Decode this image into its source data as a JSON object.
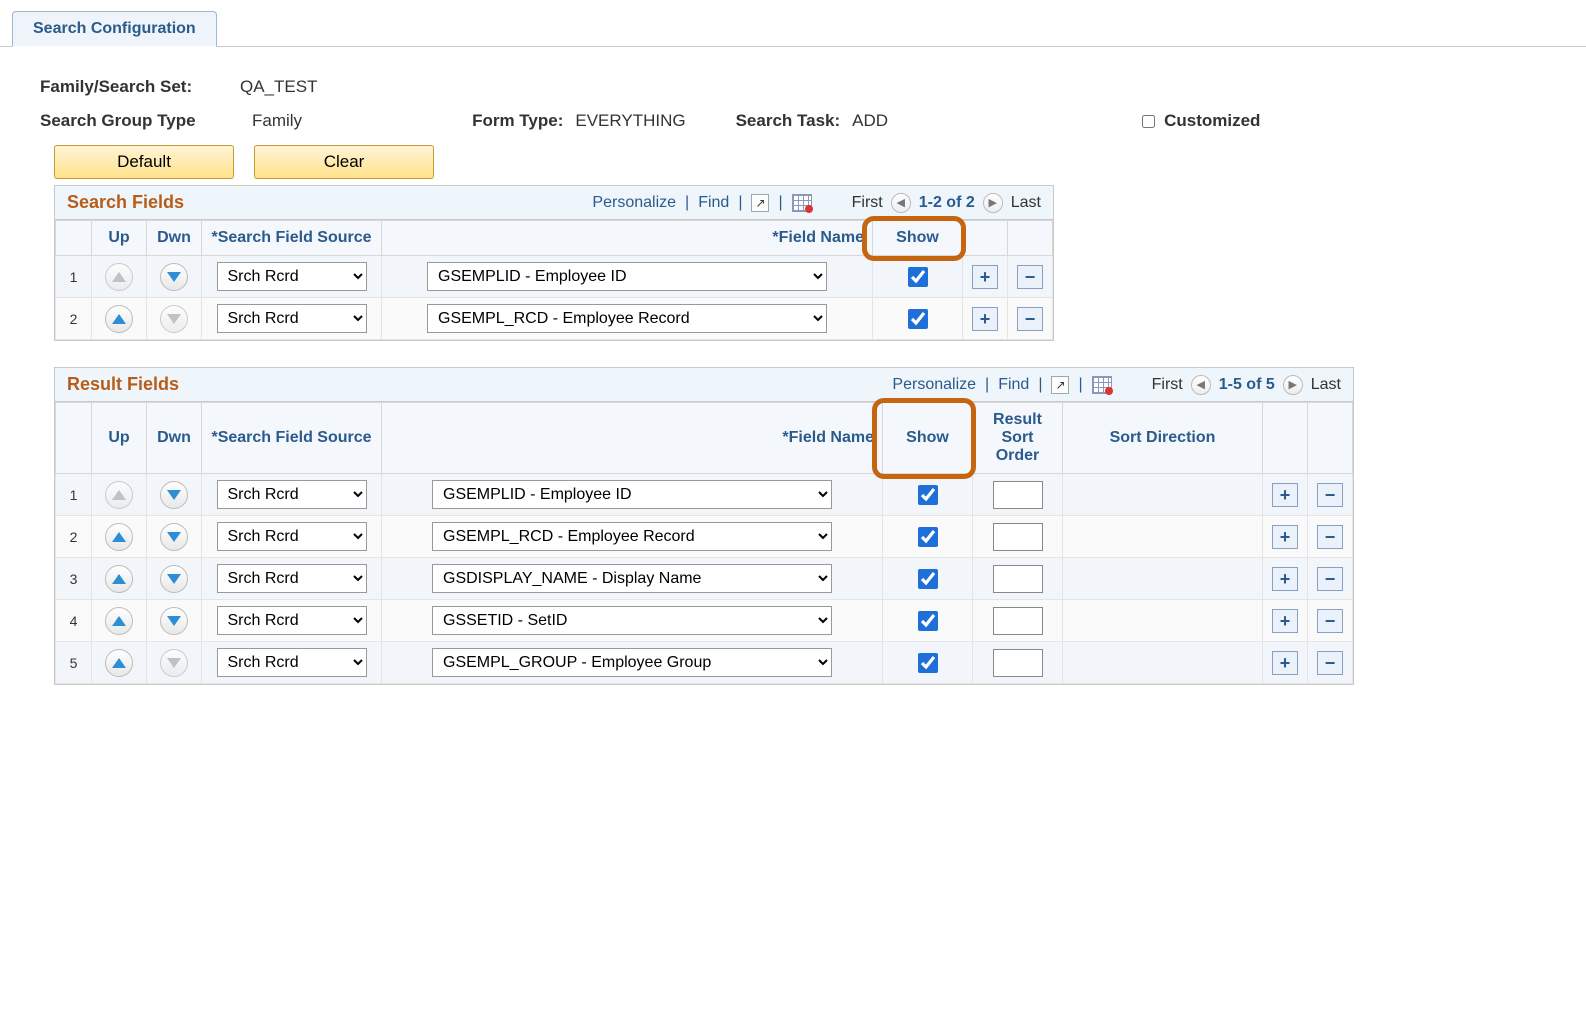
{
  "tab": {
    "label": "Search Configuration"
  },
  "header": {
    "family_label": "Family/Search Set:",
    "family_value": "QA_TEST",
    "group_type_label": "Search Group Type",
    "group_type_value": "Family",
    "form_type_label": "Form Type:",
    "form_type_value": "EVERYTHING",
    "search_task_label": "Search Task:",
    "search_task_value": "ADD",
    "customized_label": "Customized"
  },
  "buttons": {
    "default": "Default",
    "clear": "Clear"
  },
  "grid_common": {
    "personalize": "Personalize",
    "find": "Find",
    "first": "First",
    "last": "Last"
  },
  "search_grid": {
    "title": "Search Fields",
    "nav_info": "1-2 of 2",
    "cols": {
      "up": "Up",
      "dwn": "Dwn",
      "source": "*Search Field Source",
      "field": "*Field Name",
      "show": "Show"
    },
    "rows": [
      {
        "n": "1",
        "up_enabled": false,
        "dwn_enabled": true,
        "source": "Srch Rcrd",
        "field": "GSEMPLID - Employee ID",
        "show": true
      },
      {
        "n": "2",
        "up_enabled": true,
        "dwn_enabled": false,
        "source": "Srch Rcrd",
        "field": "GSEMPL_RCD - Employee Record",
        "show": true
      }
    ]
  },
  "result_grid": {
    "title": "Result Fields",
    "nav_info": "1-5 of 5",
    "cols": {
      "up": "Up",
      "dwn": "Dwn",
      "source": "*Search Field Source",
      "field": "*Field Name",
      "show": "Show",
      "sort": "Result Sort Order",
      "dir": "Sort Direction"
    },
    "rows": [
      {
        "n": "1",
        "up_enabled": false,
        "dwn_enabled": true,
        "source": "Srch Rcrd",
        "field": "GSEMPLID - Employee ID",
        "show": true,
        "sort": ""
      },
      {
        "n": "2",
        "up_enabled": true,
        "dwn_enabled": true,
        "source": "Srch Rcrd",
        "field": "GSEMPL_RCD - Employee Record",
        "show": true,
        "sort": ""
      },
      {
        "n": "3",
        "up_enabled": true,
        "dwn_enabled": true,
        "source": "Srch Rcrd",
        "field": "GSDISPLAY_NAME - Display Name",
        "show": true,
        "sort": ""
      },
      {
        "n": "4",
        "up_enabled": true,
        "dwn_enabled": true,
        "source": "Srch Rcrd",
        "field": "GSSETID - SetID",
        "show": true,
        "sort": ""
      },
      {
        "n": "5",
        "up_enabled": true,
        "dwn_enabled": false,
        "source": "Srch Rcrd",
        "field": "GSEMPL_GROUP - Employee Group",
        "show": true,
        "sort": ""
      }
    ]
  }
}
